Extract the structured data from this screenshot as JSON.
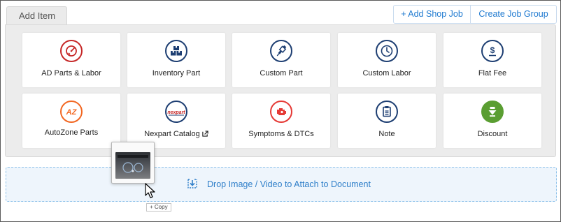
{
  "tab": {
    "label": "Add Item"
  },
  "header_buttons": {
    "add_shop_job": "+ Add Shop Job",
    "create_job_group": "Create Job Group"
  },
  "items": [
    {
      "label": "AD Parts & Labor",
      "icon": "parts-labor-gauge-icon",
      "color": "#c62828"
    },
    {
      "label": "Inventory Part",
      "icon": "inventory-boxes-icon",
      "color": "#1d3e72"
    },
    {
      "label": "Custom Part",
      "icon": "spark-plug-icon",
      "color": "#1d3e72"
    },
    {
      "label": "Custom Labor",
      "icon": "clock-icon",
      "color": "#1d3e72"
    },
    {
      "label": "Flat Fee",
      "icon": "dollar-icon",
      "color": "#1d3e72"
    },
    {
      "label": "AutoZone Parts",
      "icon": "autozone-logo-icon",
      "color": "#f26722"
    },
    {
      "label": "Nexpart Catalog",
      "icon": "nexpart-logo-icon",
      "color": "#1d3e72"
    },
    {
      "label": "Symptoms & DTCs",
      "icon": "engine-check-icon",
      "color": "#e53935"
    },
    {
      "label": "Note",
      "icon": "notepad-icon",
      "color": "#1d3e72"
    },
    {
      "label": "Discount",
      "icon": "discount-tag-icon",
      "color": "#5a9e32"
    }
  ],
  "logos": {
    "autozone": "AZ",
    "nexpart": "nexpart"
  },
  "drop_zone": {
    "label": "Drop Image / Video to Attach to Document"
  },
  "drag": {
    "copy_label": "+ Copy"
  }
}
